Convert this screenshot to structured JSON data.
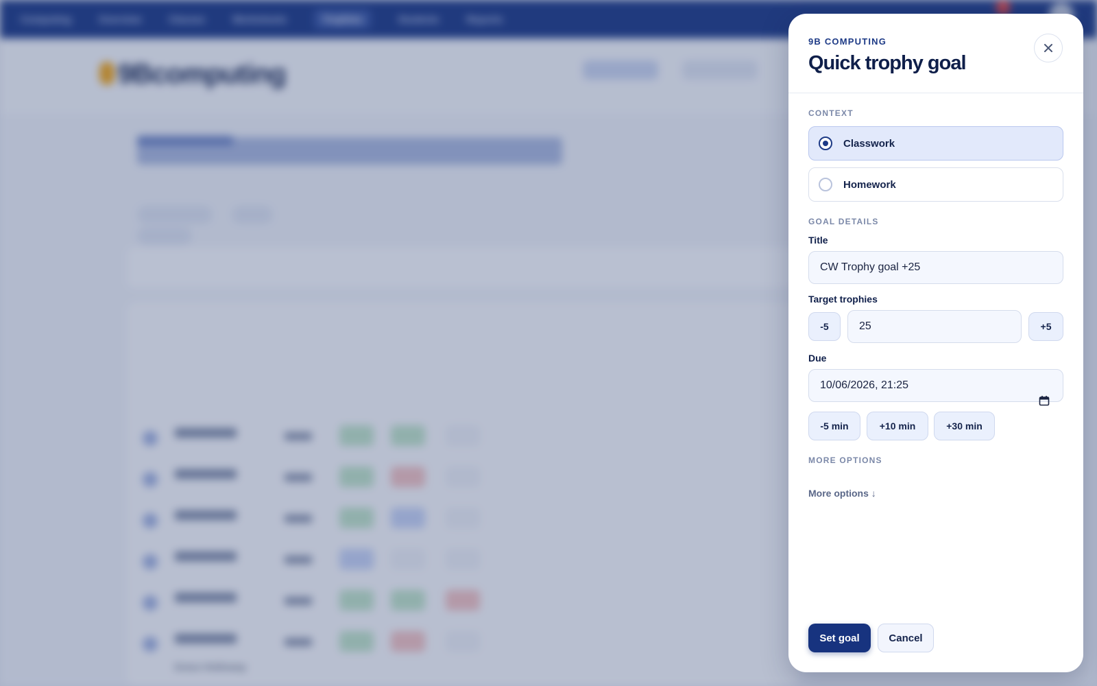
{
  "background": {
    "logo_text": "9Bcomputing",
    "nav_items": [
      "Computing",
      "Overview",
      "Classes",
      "Worksheets",
      "Trophies",
      "Students",
      "Reports"
    ],
    "last_student_name": "Grace Holloway"
  },
  "drawer": {
    "eyebrow": "9B COMPUTING",
    "title": "Quick trophy goal",
    "context": {
      "section_label": "CONTEXT",
      "options": [
        {
          "label": "Classwork",
          "selected": true
        },
        {
          "label": "Homework",
          "selected": false
        }
      ]
    },
    "goal_details": {
      "section_label": "GOAL DETAILS",
      "title_label": "Title",
      "title_value": "CW Trophy goal +25",
      "target_label": "Target trophies",
      "target_value": "25",
      "decrement_label": "-5",
      "increment_label": "+5",
      "due_label": "Due",
      "due_value": "10/06/2026, 21:25",
      "time_adjust": [
        "-5 min",
        "+10 min",
        "+30 min"
      ]
    },
    "more_options": {
      "section_label": "MORE OPTIONS",
      "link_label": "More options ↓"
    },
    "actions": {
      "primary": "Set goal",
      "secondary": "Cancel"
    }
  },
  "colors": {
    "brand": "#1d3a86",
    "primary_button": "#17337f",
    "selected_card": "#e2e9fb"
  }
}
